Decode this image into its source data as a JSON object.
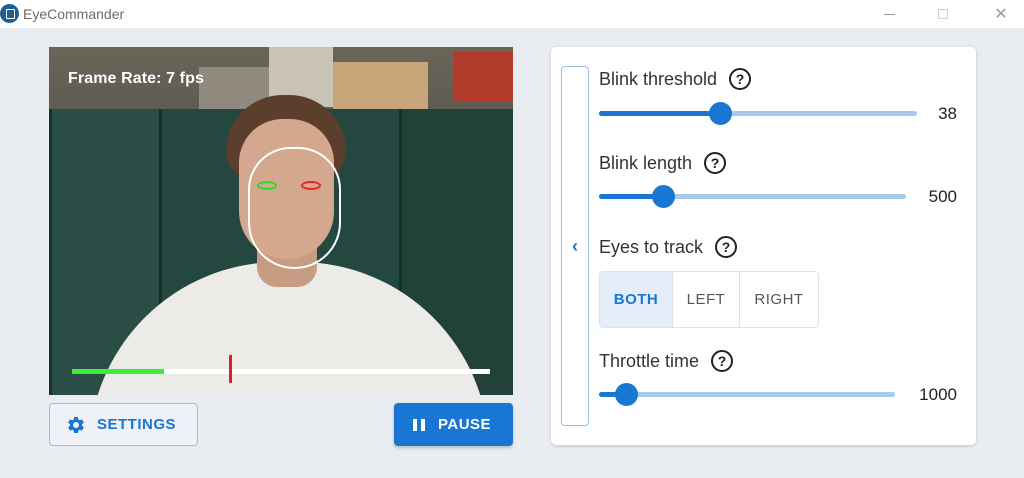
{
  "window": {
    "title": "EyeCommander",
    "minimize_glyph": "",
    "maximize_glyph": "",
    "close_glyph": "✕"
  },
  "video": {
    "frame_rate": "Frame Rate: 7 fps",
    "blink_progress_fraction": 0.22
  },
  "buttons": {
    "settings_label": "SETTINGS",
    "settings_icon": "gear-icon",
    "pause_label": "PAUSE",
    "pause_icon": "pause-icon"
  },
  "panel": {
    "collapse_glyph": "‹",
    "help_glyph": "?",
    "blink_threshold": {
      "label": "Blink threshold",
      "value": "38",
      "fraction": 0.38
    },
    "blink_length": {
      "label": "Blink length",
      "value": "500",
      "fraction": 0.21
    },
    "eyes_to_track": {
      "label": "Eyes to track",
      "options": [
        "BOTH",
        "LEFT",
        "RIGHT"
      ],
      "selected": "BOTH"
    },
    "throttle_time": {
      "label": "Throttle time",
      "value": "1000",
      "fraction": 0.09
    }
  },
  "colors": {
    "accent": "#1976d2",
    "slider_track": "#a7c9ee",
    "left_eye_marker": "#22dd22",
    "right_eye_marker": "#ee2222"
  }
}
